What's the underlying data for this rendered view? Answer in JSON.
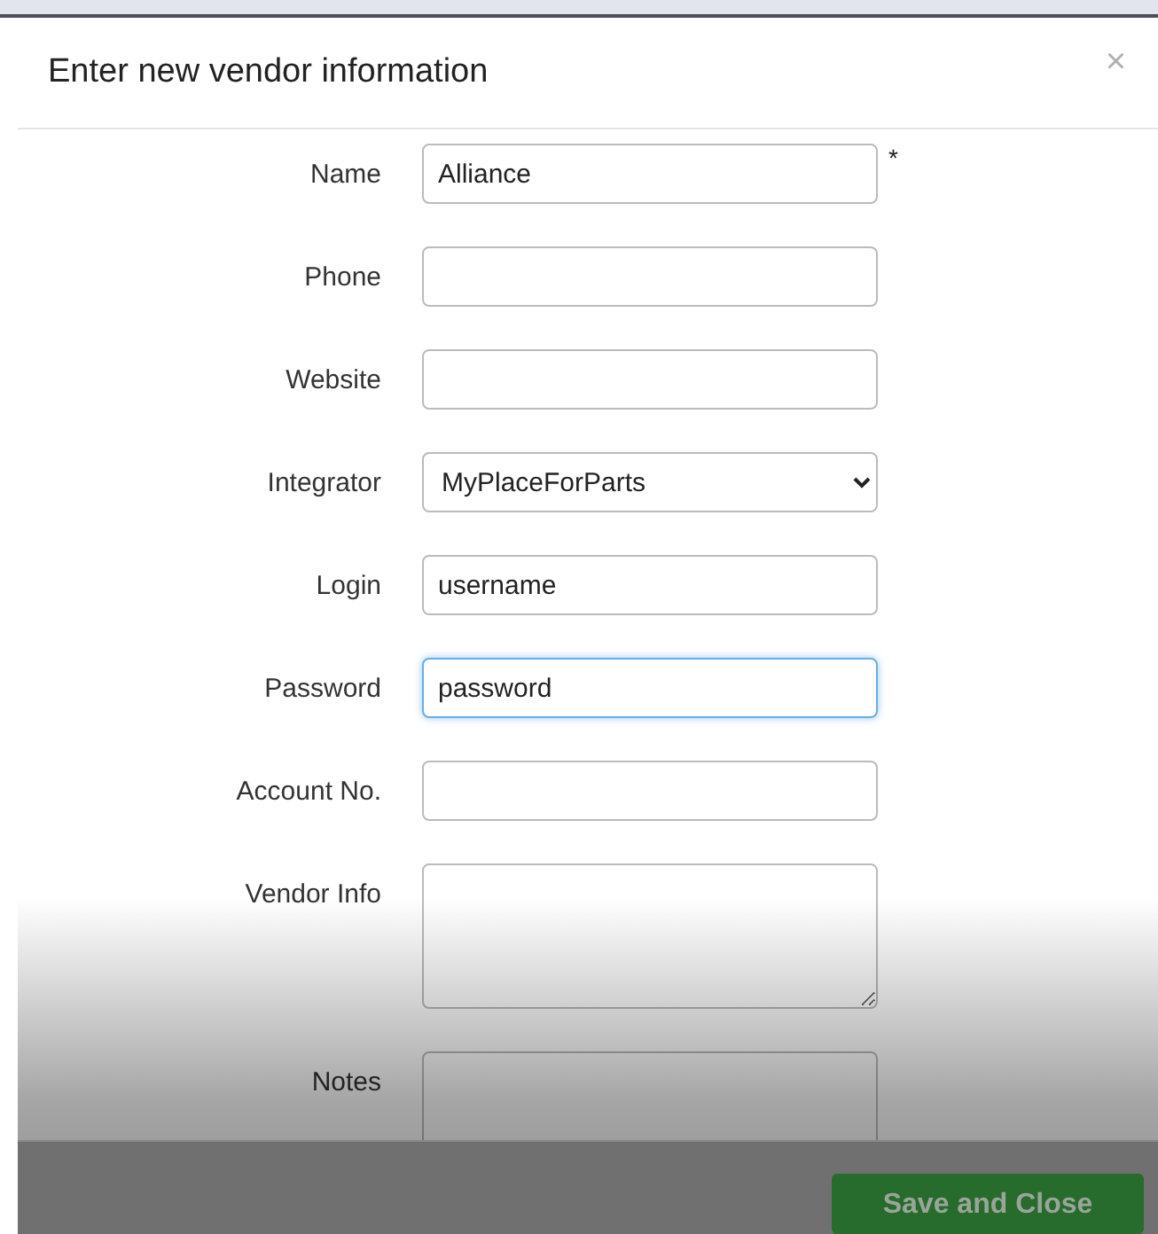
{
  "dialog": {
    "title": "Enter new vendor information",
    "close": "×"
  },
  "fields": [
    {
      "label": "Name",
      "kind": "text",
      "value": "Alliance",
      "required": "*",
      "focused": false
    },
    {
      "label": "Phone",
      "kind": "text",
      "focused": false
    },
    {
      "label": "Website",
      "kind": "text",
      "focused": false
    },
    {
      "label": "Integrator",
      "kind": "select",
      "value": "MyPlaceForParts",
      "focused": false
    },
    {
      "label": "Login",
      "kind": "text",
      "value": "username",
      "focused": false
    },
    {
      "label": "Password",
      "kind": "text",
      "value": "password",
      "focused": true
    },
    {
      "label": "Account No.",
      "kind": "text",
      "focused": false
    },
    {
      "label": "Vendor Info",
      "kind": "textarea",
      "focused": false
    },
    {
      "label": "Notes",
      "kind": "textarea",
      "focused": false
    }
  ],
  "footer": {
    "save_button": "Save and Close"
  }
}
